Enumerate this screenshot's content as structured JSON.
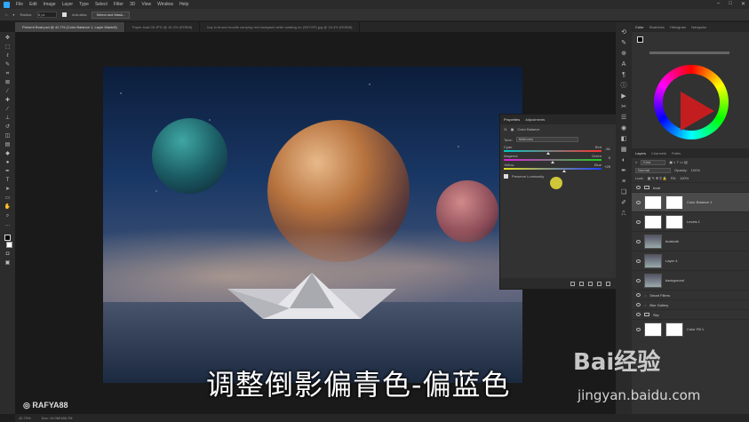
{
  "menubar": {
    "items": [
      "File",
      "Edit",
      "Image",
      "Layer",
      "Type",
      "Select",
      "Filter",
      "3D",
      "View",
      "Window",
      "Help"
    ]
  },
  "optionsbar": {
    "radius_label": "Radius:",
    "radius_value": "6 px",
    "antialias": "Anti-alias",
    "select_mask": "Select and Mask..."
  },
  "tabs": [
    "Present Boat.psd @ 42.7% (Color Balance 1, Layer Mask/8)",
    "Paper boat 05.JPG @ 16.4% (RGB/8)",
    "boy in brown hoodie carrying red backpack while walking on (SKYSP).jpg @ 16.4% (RGB/8)"
  ],
  "properties": {
    "tabs": [
      "Properties",
      "Adjustments"
    ],
    "title": "Color Balance",
    "tone_label": "Tone:",
    "tone_value": "Midtones",
    "sliders": [
      {
        "left": "Cyan",
        "right": "Red",
        "value": "-51",
        "pos": 0.45,
        "gradient": "linear-gradient(90deg,#00c8c8,#ff3030)"
      },
      {
        "left": "Magenta",
        "right": "Green",
        "value": "0",
        "pos": 0.5,
        "gradient": "linear-gradient(90deg,#e020e0,#20d020)"
      },
      {
        "left": "Yellow",
        "right": "Blue",
        "value": "+29",
        "pos": 0.62,
        "gradient": "linear-gradient(90deg,#e0e020,#2040ff)"
      }
    ],
    "preserve": "Preserve Luminosity"
  },
  "colorpanel": {
    "tabs": [
      "Color",
      "Swatches",
      "Histogram",
      "Navigator"
    ]
  },
  "layers": {
    "tabs": [
      "Layers",
      "Channels",
      "Paths"
    ],
    "kind": "Kind",
    "blend": "Normal",
    "opacity_label": "Opacity:",
    "opacity": "100%",
    "lock_label": "Lock:",
    "fill_label": "Fill:",
    "fill": "100%",
    "rows": [
      {
        "name": "boat",
        "type": "group"
      },
      {
        "name": "Color Balance 1",
        "type": "adjust"
      },
      {
        "name": "Levels 1",
        "type": "adjust"
      },
      {
        "name": "boatcolk",
        "type": "image"
      },
      {
        "name": "Layer 4",
        "type": "image"
      },
      {
        "name": "background",
        "type": "image"
      },
      {
        "name": "Smart Filters",
        "type": "filter"
      },
      {
        "name": "Blur Gallery",
        "type": "filter"
      },
      {
        "name": "Sky",
        "type": "group"
      },
      {
        "name": "Color Fill 1",
        "type": "adjust"
      }
    ]
  },
  "status": {
    "zoom": "42.73%",
    "doc": "Doc: 19.0M/186.7M"
  },
  "watermark": {
    "handle": "RAFYA88"
  },
  "caption": "调整倒影偏青色-偏蓝色",
  "baidu": {
    "logo": "Bai经验",
    "url": "jingyan.baidu.com"
  }
}
